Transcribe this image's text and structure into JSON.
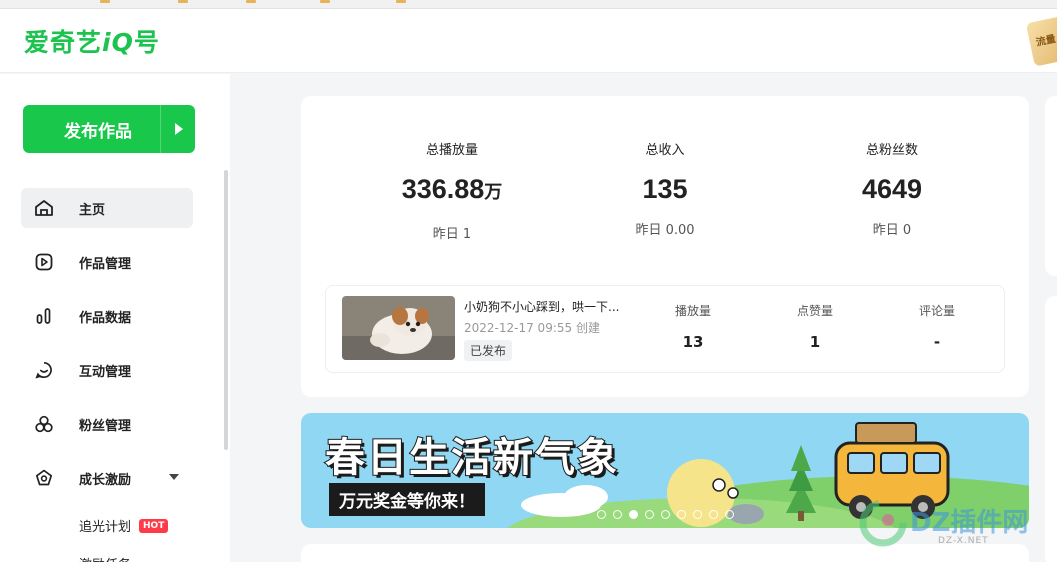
{
  "header": {
    "logo_prefix": "爱奇艺",
    "logo_iq": "iQ",
    "logo_suffix": "号",
    "corner_badge": "流量"
  },
  "sidebar": {
    "publish_label": "发布作品",
    "items": [
      {
        "label": "主页",
        "icon": "home-icon",
        "active": true
      },
      {
        "label": "作品管理",
        "icon": "play-square-icon"
      },
      {
        "label": "作品数据",
        "icon": "bar-chart-icon"
      },
      {
        "label": "互动管理",
        "icon": "chat-bubble-icon"
      },
      {
        "label": "粉丝管理",
        "icon": "fans-icon"
      },
      {
        "label": "成长激励",
        "icon": "badge-icon",
        "expanded": true
      }
    ],
    "sub_items": [
      {
        "label": "追光计划",
        "badge": "HOT"
      },
      {
        "label": "激励任务"
      }
    ]
  },
  "stats": [
    {
      "title": "总播放量",
      "value": "336.88",
      "unit": "万",
      "sub": "昨日 1"
    },
    {
      "title": "总收入",
      "value": "135",
      "unit": "",
      "sub": "昨日 0.00"
    },
    {
      "title": "总粉丝数",
      "value": "4649",
      "unit": "",
      "sub": "昨日 0"
    }
  ],
  "latest_video": {
    "title": "小奶狗不小心踩到，哄一下...",
    "date": "2022-12-17 09:55 创建",
    "status": "已发布",
    "metrics": [
      {
        "label": "播放量",
        "value": "13"
      },
      {
        "label": "点赞量",
        "value": "1"
      },
      {
        "label": "评论量",
        "value": "-"
      }
    ]
  },
  "banner": {
    "title": "春日生活新气象",
    "subtitle": "万元奖金等你来！",
    "slide_count": 9,
    "active_slide": 2
  },
  "watermark": {
    "text": "DZ插件网",
    "sub": "DZ-X.NET"
  },
  "colors": {
    "brand_green": "#19c84b",
    "hot_red": "#ff3b4a",
    "banner_sky": "#8fd7f2"
  }
}
